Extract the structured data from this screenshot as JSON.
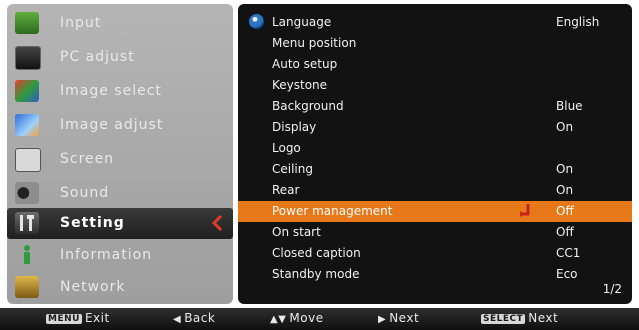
{
  "left_menu": {
    "items": [
      {
        "label": "Input",
        "icon": "input-icon"
      },
      {
        "label": "PC adjust",
        "icon": "pc-adjust-icon"
      },
      {
        "label": "Image select",
        "icon": "image-select-icon"
      },
      {
        "label": "Image adjust",
        "icon": "image-adjust-icon"
      },
      {
        "label": "Screen",
        "icon": "screen-icon"
      },
      {
        "label": "Sound",
        "icon": "sound-icon"
      },
      {
        "label": "Setting",
        "icon": "setting-icon"
      },
      {
        "label": "Information",
        "icon": "information-icon"
      },
      {
        "label": "Network",
        "icon": "network-icon"
      }
    ],
    "active_label": "Setting"
  },
  "settings": {
    "rows": [
      {
        "name": "Language",
        "value": "English"
      },
      {
        "name": "Menu position",
        "value": ""
      },
      {
        "name": "Auto setup",
        "value": ""
      },
      {
        "name": "Keystone",
        "value": ""
      },
      {
        "name": "Background",
        "value": "Blue"
      },
      {
        "name": "Display",
        "value": "On"
      },
      {
        "name": "Logo",
        "value": ""
      },
      {
        "name": "Ceiling",
        "value": "On"
      },
      {
        "name": "Rear",
        "value": "On"
      },
      {
        "name": "Power management",
        "value": "Off"
      },
      {
        "name": "On start",
        "value": "Off"
      },
      {
        "name": "Closed caption",
        "value": "CC1"
      },
      {
        "name": "Standby mode",
        "value": "Eco"
      }
    ],
    "selected_name": "Power management",
    "page_indicator": "1/2"
  },
  "bottom_bar": {
    "exit_key": "MENU",
    "exit_label": "Exit",
    "back_label": "Back",
    "move_label": "Move",
    "next_label": "Next",
    "select_key": "SELECT",
    "select_label": "Next"
  },
  "colors": {
    "highlight": "#e7781a",
    "panel": "#121212",
    "active_arrow": "#e03a2e"
  }
}
